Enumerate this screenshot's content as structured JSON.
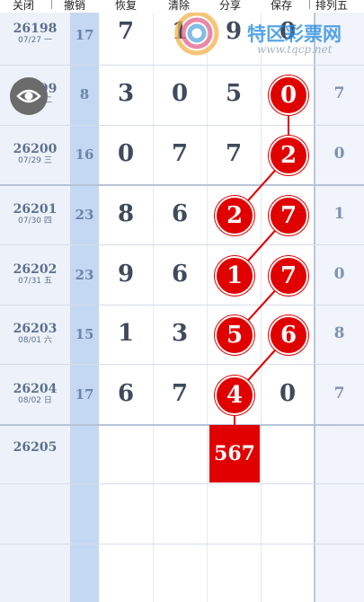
{
  "toolbar": {
    "close": "关闭",
    "undo": "撤销",
    "restore": "恢复",
    "clear": "清除",
    "share": "分享",
    "save": "保存",
    "game": "排列五"
  },
  "watermark": {
    "name": "特区彩票网",
    "url": "www.tqcp.net"
  },
  "rows": [
    {
      "period": "26198",
      "date": "07/27 一",
      "sum": "17",
      "digits": [
        "7",
        "1",
        "9",
        "0"
      ],
      "right": ""
    },
    {
      "period": "26199",
      "date": "07/28 二",
      "sum": "8",
      "digits": [
        "3",
        "0",
        "5",
        "0"
      ],
      "right": "7"
    },
    {
      "period": "26200",
      "date": "07/29 三",
      "sum": "16",
      "digits": [
        "0",
        "7",
        "7",
        "2"
      ],
      "right": "0"
    },
    {
      "period": "26201",
      "date": "07/30 四",
      "sum": "23",
      "digits": [
        "8",
        "6",
        "2",
        "7"
      ],
      "right": "1"
    },
    {
      "period": "26202",
      "date": "07/31 五",
      "sum": "23",
      "digits": [
        "9",
        "6",
        "1",
        "7"
      ],
      "right": "0"
    },
    {
      "period": "26203",
      "date": "08/01 六",
      "sum": "15",
      "digits": [
        "1",
        "3",
        "5",
        "6"
      ],
      "right": "8"
    },
    {
      "period": "26204",
      "date": "08/02 日",
      "sum": "17",
      "digits": [
        "6",
        "7",
        "4",
        "0"
      ],
      "right": "7"
    }
  ],
  "next": {
    "period": "26205",
    "prediction": "567"
  },
  "colors": {
    "ball": "#e00000",
    "sum_column": "#c5d8f3",
    "period_column": "#edf2fa"
  }
}
